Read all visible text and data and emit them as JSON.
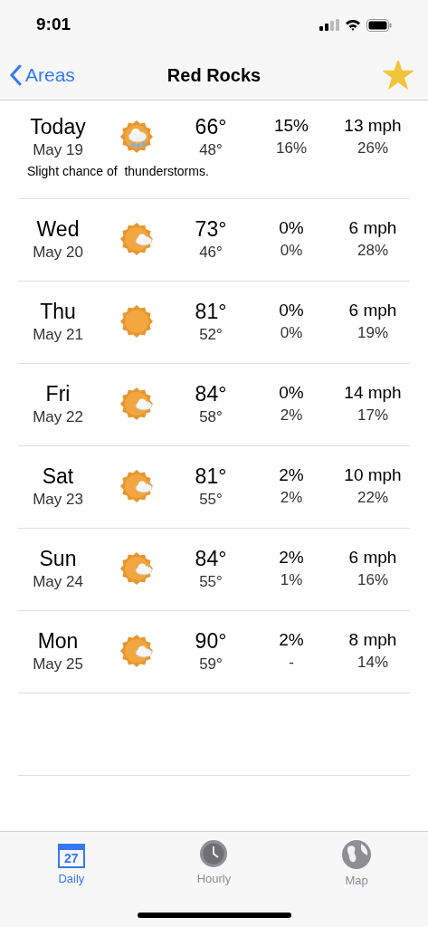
{
  "status_bar": {
    "time": "9:01"
  },
  "nav": {
    "back": "Areas",
    "title": "Red Rocks",
    "favorite": true
  },
  "days": [
    {
      "day": "Today",
      "date": "May 19",
      "kind": "storm",
      "high": "66°",
      "low": "48°",
      "precip_1": "15%",
      "precip_2": "16%",
      "wind": "13 mph",
      "humidity": "26%",
      "note": "Slight chance of  thunderstorms."
    },
    {
      "day": "Wed",
      "date": "May 20",
      "kind": "partly",
      "high": "73°",
      "low": "46°",
      "precip_1": "0%",
      "precip_2": "0%",
      "wind": "6 mph",
      "humidity": "28%"
    },
    {
      "day": "Thu",
      "date": "May 21",
      "kind": "sunny",
      "high": "81°",
      "low": "52°",
      "precip_1": "0%",
      "precip_2": "0%",
      "wind": "6 mph",
      "humidity": "19%"
    },
    {
      "day": "Fri",
      "date": "May 22",
      "kind": "partly",
      "high": "84°",
      "low": "58°",
      "precip_1": "0%",
      "precip_2": "2%",
      "wind": "14 mph",
      "humidity": "17%"
    },
    {
      "day": "Sat",
      "date": "May 23",
      "kind": "partly",
      "high": "81°",
      "low": "55°",
      "precip_1": "2%",
      "precip_2": "2%",
      "wind": "10 mph",
      "humidity": "22%"
    },
    {
      "day": "Sun",
      "date": "May 24",
      "kind": "partly",
      "high": "84°",
      "low": "55°",
      "precip_1": "2%",
      "precip_2": "1%",
      "wind": "6 mph",
      "humidity": "16%"
    },
    {
      "day": "Mon",
      "date": "May 25",
      "kind": "partly",
      "high": "90°",
      "low": "59°",
      "precip_1": "2%",
      "precip_2": "-",
      "wind": "8 mph",
      "humidity": "14%"
    }
  ],
  "tabs": [
    {
      "label": "Daily",
      "kind": "calendar",
      "day_number": "27",
      "selected": true
    },
    {
      "label": "Hourly",
      "kind": "clock",
      "selected": false
    },
    {
      "label": "Map",
      "kind": "globe",
      "selected": false
    }
  ]
}
